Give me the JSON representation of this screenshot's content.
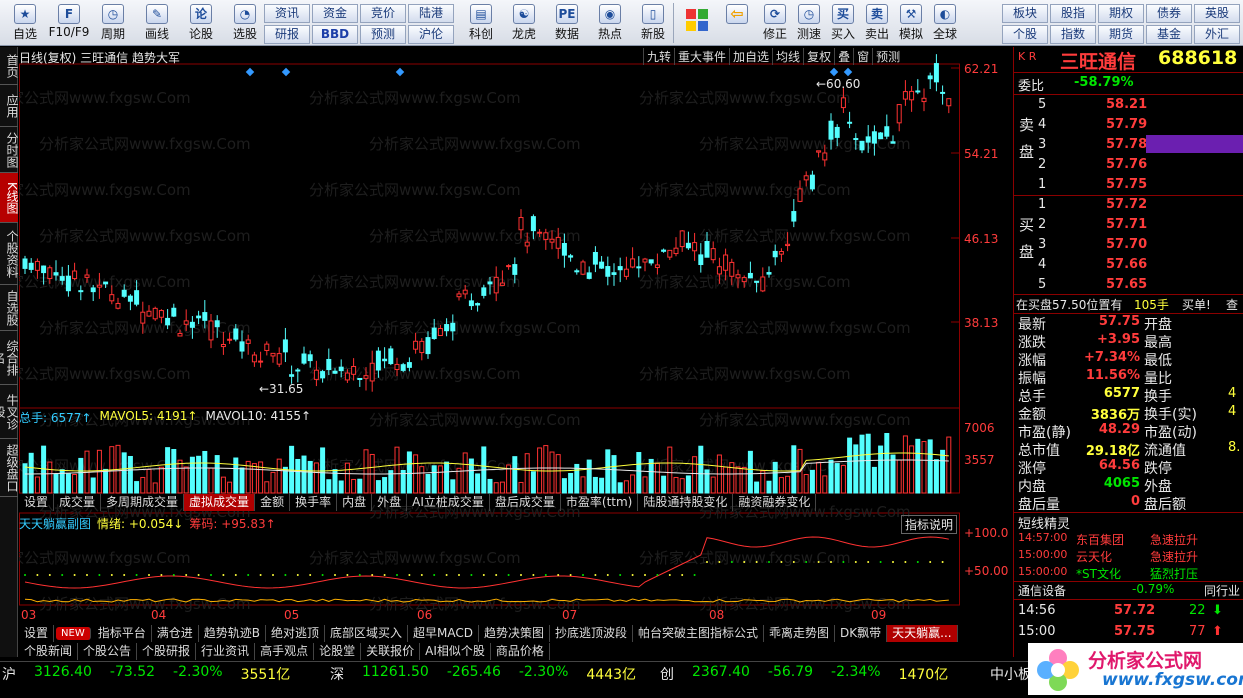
{
  "toolbar": {
    "buttons": [
      {
        "label": "自选",
        "icon": "★"
      },
      {
        "label": "F10/F9",
        "icon": "F"
      },
      {
        "label": "周期",
        "icon": "◷"
      },
      {
        "label": "画线",
        "icon": "✎"
      },
      {
        "label": "论股",
        "icon": "论"
      },
      {
        "label": "选股",
        "icon": "◔"
      }
    ],
    "small_buttons": [
      "资讯",
      "资金",
      "竞价",
      "陆港",
      "研报",
      "BBD",
      "预测",
      "沪伦"
    ],
    "buttons2": [
      {
        "label": "科创",
        "icon": "▤"
      },
      {
        "label": "龙虎",
        "icon": "☯"
      },
      {
        "label": "数据",
        "icon": "PE"
      },
      {
        "label": "热点",
        "icon": "◉"
      },
      {
        "label": "新股",
        "icon": "▯"
      }
    ],
    "buttons3": [
      {
        "label": "后退",
        "icon": "⇦"
      },
      {
        "label": "修正",
        "icon": "⟳"
      },
      {
        "label": "测速",
        "icon": "◷"
      },
      {
        "label": "买入",
        "icon": "买"
      },
      {
        "label": "卖出",
        "icon": "卖"
      },
      {
        "label": "模拟",
        "icon": "⚒"
      },
      {
        "label": "全球",
        "icon": "◐"
      }
    ],
    "small_buttons2": [
      "板块",
      "股指",
      "期权",
      "债券",
      "英股",
      "个股",
      "指数",
      "期货",
      "基金",
      "外汇"
    ]
  },
  "left_tabs": [
    "首页",
    "应用",
    "分时图",
    "K线图",
    "个股资料",
    "自选股",
    "综合排名",
    "牛叉诊股",
    "超级盘口"
  ],
  "chart": {
    "header": "日线(复权) 三旺通信 趋势大军",
    "top_buttons": [
      "九转",
      "重大事件",
      "加自选",
      "均线",
      "复权",
      "叠",
      "窗",
      "预测"
    ],
    "price_ticks": [
      "62.21",
      "54.21",
      "46.13",
      "38.13"
    ],
    "high_label": "60.60",
    "low_label": "31.65",
    "vol_header": {
      "total": "总手: 6577↑",
      "ma5": "MAVOL5: 4191↑",
      "ma10": "MAVOL10: 4155↑"
    },
    "vol_ticks": [
      "7006",
      "3557"
    ],
    "vol_tabs": [
      "设置",
      "成交量",
      "多周期成交量",
      "虚拟成交量",
      "金额",
      "换手率",
      "内盘",
      "外盘",
      "AI立桩成交量",
      "盘后成交量",
      "市盈率(ttm)",
      "陆股通持股变化",
      "融资融券变化"
    ],
    "ind_header": {
      "name": "天天躺赢副图",
      "qx": "情绪: +0.054↓",
      "cm": "筹码: +95.83↑",
      "btn": "指标说明"
    },
    "ind_ticks": [
      "+100.0",
      "+50.00"
    ],
    "months": [
      "03",
      "04",
      "05",
      "06",
      "07",
      "08",
      "09"
    ],
    "bottom_tabs": [
      "设置",
      "NEW",
      "指标平台",
      "满仓进",
      "趋势轨迹B",
      "绝对逃顶",
      "底部区域买入",
      "超早MACD",
      "趋势决策图",
      "抄底逃顶波段",
      "帕台突破主图指标公式",
      "乖离走势图",
      "DK飘带",
      "天天躺赢..."
    ],
    "bottom_tabs2": [
      "个股新闻",
      "个股公告",
      "个股研报",
      "行业资讯",
      "高手观点",
      "论股堂",
      "关联报价",
      "AI相似个股",
      "商品价格"
    ],
    "watermark": "分析家公式网www.fxgsw.Com"
  },
  "quote": {
    "name": "三旺通信",
    "code": "688618",
    "weibi_label": "委比",
    "weibi": "-58.79%",
    "sell": [
      {
        "n": "5",
        "p": "58.21"
      },
      {
        "n": "4",
        "p": "57.79"
      },
      {
        "n": "3",
        "p": "57.78"
      },
      {
        "n": "2",
        "p": "57.76"
      },
      {
        "n": "1",
        "p": "57.75"
      }
    ],
    "buy": [
      {
        "n": "1",
        "p": "57.72"
      },
      {
        "n": "2",
        "p": "57.71"
      },
      {
        "n": "3",
        "p": "57.70"
      },
      {
        "n": "4",
        "p": "57.66"
      },
      {
        "n": "5",
        "p": "57.65"
      }
    ],
    "sell_label": "卖盘",
    "buy_label": "买盘",
    "bar": {
      "a": "在买盘57.50位置有",
      "b": "105手",
      "c": "买单!",
      "d": "查"
    },
    "stats": [
      [
        "最新",
        "57.75",
        "开盘",
        ""
      ],
      [
        "涨跌",
        "+3.95",
        "最高",
        ""
      ],
      [
        "涨幅",
        "+7.34%",
        "最低",
        ""
      ],
      [
        "振幅",
        "11.56%",
        "量比",
        ""
      ],
      [
        "总手",
        "6577",
        "换手",
        "4"
      ],
      [
        "金额",
        "3836万",
        "换手(实)",
        "4"
      ],
      [
        "市盈(静)",
        "48.29",
        "市盈(动)",
        ""
      ],
      [
        "总市值",
        "29.18亿",
        "流通值",
        "8."
      ],
      [
        "涨停",
        "64.56",
        "跌停",
        ""
      ],
      [
        "内盘",
        "4065",
        "外盘",
        ""
      ],
      [
        "盘后量",
        "0",
        "盘后额",
        ""
      ]
    ],
    "short_title": "短线精灵",
    "short": [
      [
        "14:57:00",
        "东百集团",
        "急速拉升"
      ],
      [
        "15:00:00",
        "云天化",
        "急速拉升"
      ],
      [
        "15:00:00",
        "*ST文化",
        "猛烈打压"
      ]
    ],
    "sector": "通信设备",
    "sector_pct": "-0.79%",
    "sector_lbl": "同行业",
    "ticks": [
      [
        "14:56",
        "57.72",
        "22"
      ],
      [
        "15:00",
        "57.75",
        "77"
      ]
    ]
  },
  "status": [
    {
      "name": "沪",
      "v": "3126.40",
      "c": "-73.52",
      "p": "-2.30%",
      "a": "3551亿"
    },
    {
      "name": "深",
      "v": "11261.50",
      "c": "-265.46",
      "p": "-2.30%",
      "a": "4443亿"
    },
    {
      "name": "创",
      "v": "2367.40",
      "c": "-56.79",
      "p": "-2.34%",
      "a": "1470亿"
    },
    {
      "name": "中小板",
      "v": "",
      "c": "",
      "p": "",
      "a": ""
    }
  ],
  "logo": {
    "cn": "分析家公式网",
    "url": "www.fxgsw.com"
  }
}
